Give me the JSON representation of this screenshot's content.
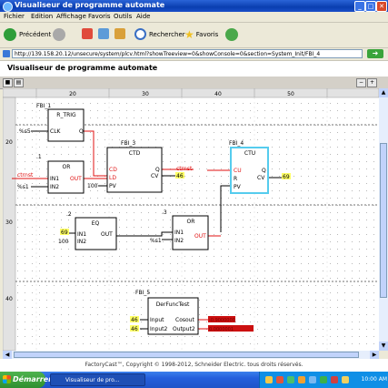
{
  "window": {
    "title": "Visualiseur de programme automate"
  },
  "menu": [
    "Fichier",
    "Edition",
    "Affichage",
    "Favoris",
    "Outils",
    "Aide"
  ],
  "toolbar": {
    "back": "Précédent",
    "search": "Rechercher",
    "favorites": "Favoris"
  },
  "address": {
    "url": "http://139.158.20.12/unsecure/system/plcv.html?showTreeview=0&showConsole=0&section=System_Init/FBI_4"
  },
  "page": {
    "title": "Visualiseur de programme automate"
  },
  "ruler": {
    "columns": [
      "20",
      "30",
      "40",
      "50"
    ],
    "rows": [
      "20",
      "30",
      "40"
    ]
  },
  "blocks": {
    "fbi1": {
      "instance": "FBI_1",
      "type": "R_TRIG",
      "pin_in": "CLK",
      "pin_out": "Q",
      "input_var": "%s5"
    },
    "or1": {
      "step": ".1",
      "type": "OR",
      "pin_in1": "IN1",
      "pin_in2": "IN2",
      "pin_out": "OUT",
      "in1_var": "ctrnst",
      "in2_var": "%s1"
    },
    "fbi3": {
      "instance": "FBI_3",
      "type": "CTD",
      "pin_cd": "CD",
      "pin_ld": "LD",
      "pin_pv": "PV",
      "pin_q": "Q",
      "pin_cv": "CV",
      "q_value": "ctrnst",
      "cv_value": "46",
      "pv_value": "100"
    },
    "fbi4": {
      "instance": "FBI_4",
      "type": "CTU",
      "pin_cu": "CU",
      "pin_r": "R",
      "pin_pv": "PV",
      "pin_q": "Q",
      "pin_cv": "CV",
      "cv_value": "69"
    },
    "eq2": {
      "step": ".2",
      "type": "EQ",
      "pin_in1": "IN1",
      "pin_in2": "IN2",
      "pin_out": "OUT",
      "in1_value": "69",
      "in2_value": "100"
    },
    "or3": {
      "step": ".3",
      "type": "OR",
      "pin_in1": "IN1",
      "pin_in2": "IN2",
      "pin_out": "OUT",
      "in2_var": "%s1"
    },
    "fbi5": {
      "instance": "FBI_5",
      "type": "DerFuncTest",
      "pin_in1": "Input",
      "pin_in2": "Input2",
      "pin_out1": "Cosout",
      "pin_out2": "Output2",
      "in1_value": "46",
      "in2_value": "46",
      "out1_value": "-0.9000000",
      "out2_value": "0.0000001"
    }
  },
  "footer": {
    "text": "FactoryCast™, Copyright © 1998-2012, Schneider Electric. tous droits réservés."
  },
  "taskbar": {
    "start": "Démarrer",
    "task": "Visualiseur de pro...",
    "clock": "10:00 AM"
  },
  "colors": {
    "active_wire": "#e01010",
    "inactive_wire": "#000000",
    "selected_block": "#55ccee",
    "value_bg": "#ffff66"
  }
}
